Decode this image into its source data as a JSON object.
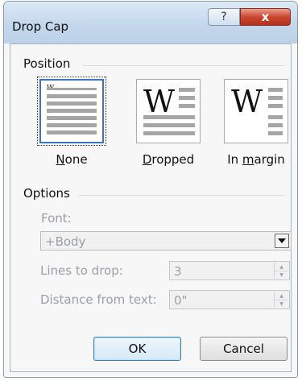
{
  "window": {
    "title": "Drop Cap",
    "help_label": "?",
    "close_label": "x"
  },
  "position": {
    "heading": "Position",
    "options": [
      {
        "label_access": "N",
        "label_rest": "one",
        "glyph": "W",
        "selected": true
      },
      {
        "label_access": "D",
        "label_rest": "ropped",
        "glyph": "W",
        "selected": false
      },
      {
        "label_pre": "In ",
        "label_access": "m",
        "label_rest": "argin",
        "glyph": "W",
        "selected": false
      }
    ]
  },
  "options": {
    "heading": "Options",
    "font_label": "Font:",
    "font_value": "+Body",
    "lines_label": "Lines to drop:",
    "lines_value": "3",
    "distance_label": "Distance from text:",
    "distance_value": "0\""
  },
  "buttons": {
    "ok": "OK",
    "cancel": "Cancel"
  },
  "colors": {
    "selection_border": "#3b74c7",
    "close_button": "#c9472f",
    "disabled_text": "#9aa0a6"
  },
  "icons": {
    "dropdown": "chevron-down-icon",
    "spin_up": "spin-up-icon",
    "spin_down": "spin-down-icon"
  }
}
